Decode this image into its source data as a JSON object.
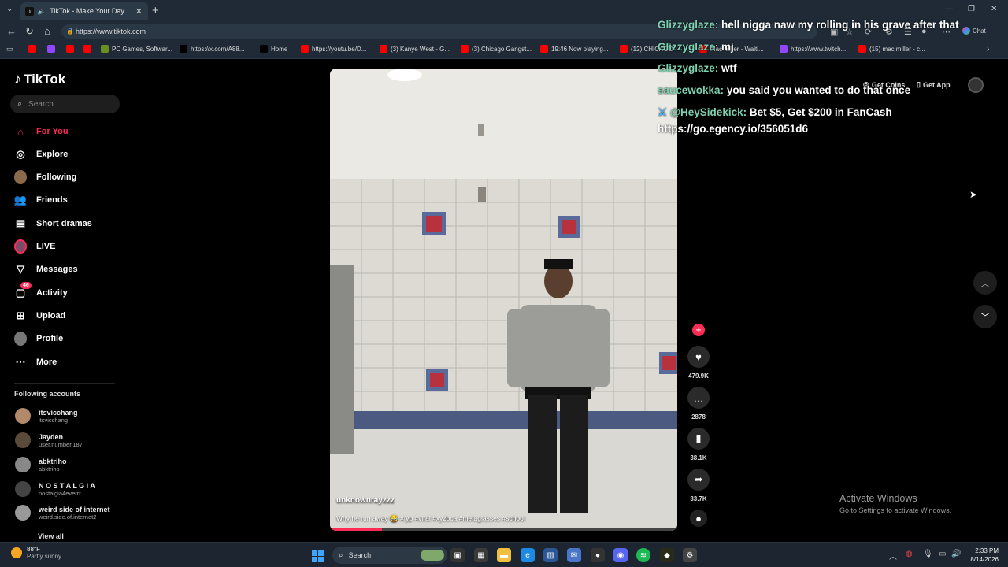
{
  "browser": {
    "tab_title": "TikTok - Make Your Day",
    "url": "https://www.tiktok.com",
    "chat_label": "Chat",
    "bookmarks": [
      {
        "label": "",
        "color": "#ff0000"
      },
      {
        "label": "",
        "color": "#9146ff"
      },
      {
        "label": "",
        "color": "#ff0000"
      },
      {
        "label": "",
        "color": "#ff0000"
      },
      {
        "label": "PC Games, Softwar...",
        "color": "#6b8e23"
      },
      {
        "label": "https://x.com/A88...",
        "color": "#000000"
      },
      {
        "label": "Home",
        "color": "#000000"
      },
      {
        "label": "https://youtu.be/D...",
        "color": "#ff0000"
      },
      {
        "label": "(3) Kanye West - G...",
        "color": "#ff0000"
      },
      {
        "label": "(3) Chicago Gangst...",
        "color": "#ff0000"
      },
      {
        "label": "19:46 Now playing...",
        "color": "#ff0000"
      },
      {
        "label": "(12) CHICAGO",
        "color": "#ff0000"
      },
      {
        "label": "Mac Miller - Waiti...",
        "color": "#ff0000"
      },
      {
        "label": "https://www.twitch...",
        "color": "#9146ff"
      },
      {
        "label": "(15) mac miller - c...",
        "color": "#ff0000"
      }
    ]
  },
  "tiktok": {
    "logo": "TikTok",
    "search_placeholder": "Search",
    "nav": [
      {
        "label": "For You",
        "icon": "home-icon",
        "active": true
      },
      {
        "label": "Explore",
        "icon": "compass-icon"
      },
      {
        "label": "Following",
        "icon": "following-avatar"
      },
      {
        "label": "Friends",
        "icon": "friends-icon"
      },
      {
        "label": "Short dramas",
        "icon": "film-icon"
      },
      {
        "label": "LIVE",
        "icon": "live-avatar"
      },
      {
        "label": "Messages",
        "icon": "send-icon"
      },
      {
        "label": "Activity",
        "icon": "bell-icon",
        "badge": "46"
      },
      {
        "label": "Upload",
        "icon": "plus-square-icon"
      },
      {
        "label": "Profile",
        "icon": "profile-avatar"
      },
      {
        "label": "More",
        "icon": "more-icon"
      }
    ],
    "following_title": "Following accounts",
    "accounts": [
      {
        "name": "itsvicchang",
        "handle": "itsvicchang"
      },
      {
        "name": "Jayden",
        "handle": "user.number.187"
      },
      {
        "name": "abktriho",
        "handle": "abktriho"
      },
      {
        "name": "N O S T A L G I A",
        "handle": "nostalgia4everrr"
      },
      {
        "name": "weird side of internet",
        "handle": "weird.side.of.internet2"
      }
    ],
    "view_all": "View all",
    "get_coins": "Get Coins",
    "get_app": "Get App",
    "video": {
      "author": "unknownrayzzz",
      "caption": "Why he run away 😂 #fyp #viral #xyzbca #metaglasses #school",
      "progress": 0.15
    },
    "actions": {
      "likes": "479.9K",
      "comments": "2878",
      "saves": "38.1K",
      "shares": "33.7K"
    }
  },
  "chat_overlay": [
    {
      "user": "Glizzyglaze:",
      "msg": "hell nigga naw my rolling in his grave after that"
    },
    {
      "user": "Glizzyglaze:",
      "msg": "mj"
    },
    {
      "user": "Glizzyglaze:",
      "msg": "wtf"
    },
    {
      "user": "saucewokka:",
      "msg": "you said you wanted to do that once"
    },
    {
      "user": "@HeySidekick:",
      "msg": "Bet $5, Get $200 in FanCash"
    },
    {
      "user": "",
      "msg": "https://go.egency.io/356051d6"
    }
  ],
  "watermark": {
    "line1": "Activate Windows",
    "line2": "Go to Settings to activate Windows."
  },
  "taskbar": {
    "temp": "88°F",
    "weather": "Partly sunny",
    "search": "Search",
    "time": "2:33 PM",
    "date": "8/14/2026"
  }
}
